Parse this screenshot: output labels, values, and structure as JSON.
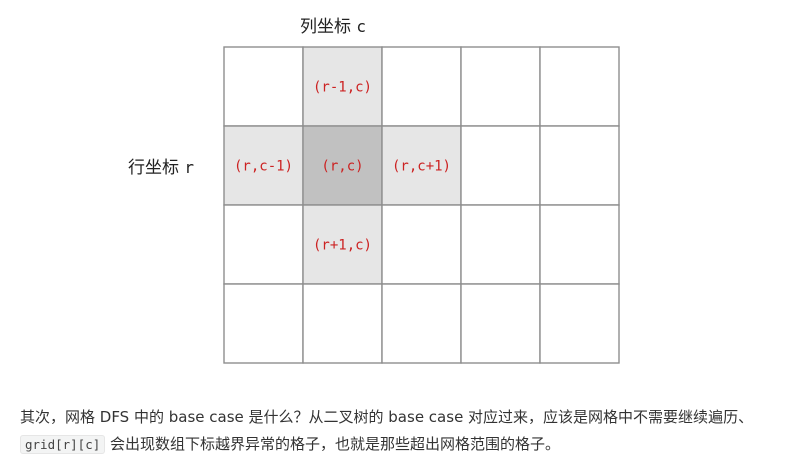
{
  "diagram": {
    "col_label_prefix": "列坐标",
    "col_label_var": "c",
    "row_label_prefix": "行坐标",
    "row_label_var": "r",
    "grid": {
      "rows": 4,
      "cols": 5
    },
    "colors": {
      "center_fill": "#c1c1c1",
      "neighbor_fill": "#e6e6e6",
      "empty_fill": "#ffffff",
      "border": "#8e8e8e",
      "label_text": "#cc2222"
    },
    "cells": [
      {
        "row": 0,
        "col": 1,
        "label": "(r-1,c)",
        "kind": "neighbor"
      },
      {
        "row": 1,
        "col": 0,
        "label": "(r,c-1)",
        "kind": "neighbor"
      },
      {
        "row": 1,
        "col": 1,
        "label": "(r,c)",
        "kind": "center"
      },
      {
        "row": 1,
        "col": 2,
        "label": "(r,c+1)",
        "kind": "neighbor"
      },
      {
        "row": 2,
        "col": 1,
        "label": "(r+1,c)",
        "kind": "neighbor"
      }
    ]
  },
  "paragraph": {
    "text_before": "其次，网格 DFS 中的 base case 是什么？从二叉树的 base case 对应过来，应该是网格中不需要继续遍历、",
    "code": "grid[r][c]",
    "text_after": "会出现数组下标越界异常的格子，也就是那些超出网格范围的格子。"
  }
}
